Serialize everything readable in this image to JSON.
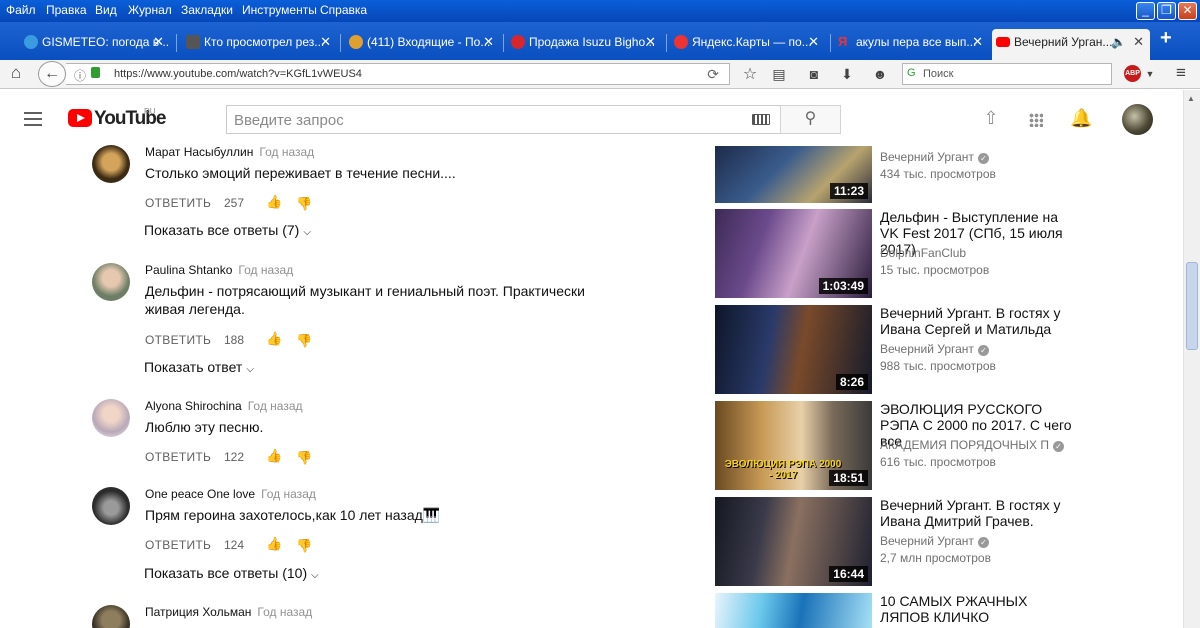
{
  "browser": {
    "menu": [
      "Файл",
      "Правка",
      "Вид",
      "Журнал",
      "Закладки",
      "Инструменты",
      "Справка"
    ],
    "tabs": [
      {
        "label": "GISMETEO: погода в ..."
      },
      {
        "label": "Кто просмотрел рез..."
      },
      {
        "label": "(411) Входящие - По..."
      },
      {
        "label": "Продажа Isuzu Bigho..."
      },
      {
        "label": "Яндекс.Карты — по..."
      },
      {
        "label": "акулы пера все вып..."
      },
      {
        "label": "Вечерний Урган..."
      }
    ],
    "url": "https://www.youtube.com/watch?v=KGfL1vWEUS4",
    "search_placeholder": "Поиск",
    "abp_label": "ABP"
  },
  "youtube": {
    "logo_text": "YouTube",
    "region": "RU",
    "search_placeholder": "Введите запрос"
  },
  "comments": [
    {
      "author": "Марат Насыбуллин",
      "time": "Год назад",
      "text": "Столько эмоций переживает в течение песни....",
      "reply": "ОТВЕТИТЬ",
      "likes": "257",
      "show_replies": "Показать все ответы (7)"
    },
    {
      "author": "Paulina Shtanko",
      "time": "Год назад",
      "text": "Дельфин - потрясающий музыкант и гениальный поэт. Практически живая легенда.",
      "reply": "ОТВЕТИТЬ",
      "likes": "188",
      "show_replies": "Показать ответ"
    },
    {
      "author": "Alyona Shirochina",
      "time": "Год назад",
      "text": "Люблю эту песню.",
      "reply": "ОТВЕТИТЬ",
      "likes": "122",
      "show_replies": ""
    },
    {
      "author": "One peace One love",
      "time": "Год назад",
      "text": "Прям героина захотелось,как 10 лет назад🎹",
      "reply": "ОТВЕТИТЬ",
      "likes": "124",
      "show_replies": "Показать все ответы (10)"
    },
    {
      "author": "Патриция Хольман",
      "time": "Год назад",
      "text": "",
      "reply": "",
      "likes": "",
      "show_replies": ""
    }
  ],
  "recommendations": [
    {
      "title": "",
      "channel": "Вечерний Ургант",
      "views": "434 тыс. просмотров",
      "duration": "11:23"
    },
    {
      "title": "Дельфин - Выступление на VK Fest 2017 (СПб, 15 июля 2017)",
      "channel": "DolphinFanClub",
      "views": "15 тыс. просмотров",
      "duration": "1:03:49"
    },
    {
      "title": "Вечерний Ургант. В гостях у Ивана Сергей и Матильда",
      "channel": "Вечерний Ургант",
      "views": "988 тыс. просмотров",
      "duration": "8:26"
    },
    {
      "title": "ЭВОЛЮЦИЯ РУССКОГО РЭПА С 2000 по 2017. С чего все",
      "channel": "АКАДЕМИЯ ПОРЯДОЧНЫХ П",
      "views": "616 тыс. просмотров",
      "duration": "18:51",
      "thumb_caption": "ЭВОЛЮЦИЯ РЭПА 2000 - 2017"
    },
    {
      "title": "Вечерний Ургант. В гостях у Ивана Дмитрий Грачев.",
      "channel": "Вечерний Ургант",
      "views": "2,7 млн просмотров",
      "duration": "16:44"
    },
    {
      "title": "10 САМЫХ РЖАЧНЫХ ЛЯПОВ КЛИЧКО",
      "channel": "",
      "views": "",
      "duration": ""
    }
  ]
}
